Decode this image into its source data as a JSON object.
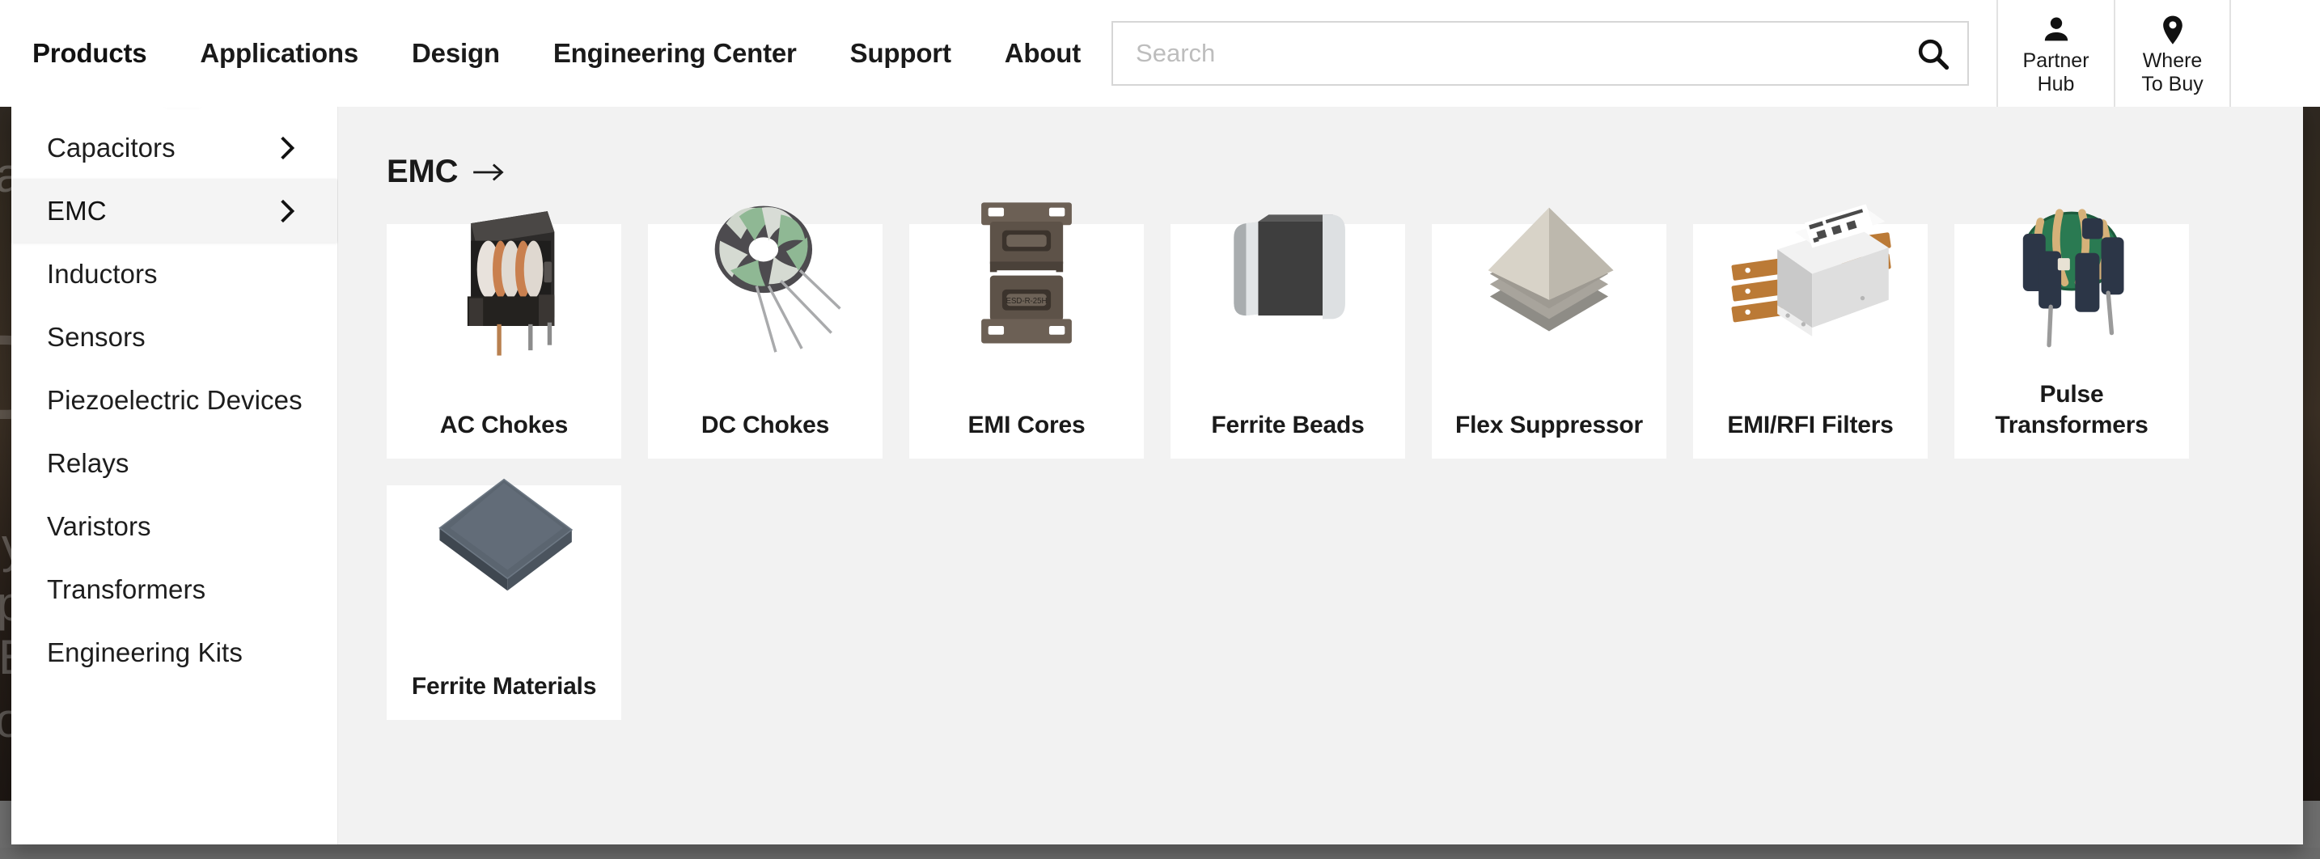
{
  "header": {
    "nav": [
      {
        "label": "Products",
        "active": true
      },
      {
        "label": "Applications",
        "active": false
      },
      {
        "label": "Design",
        "active": false
      },
      {
        "label": "Engineering Center",
        "active": false
      },
      {
        "label": "Support",
        "active": false
      },
      {
        "label": "About",
        "active": false
      }
    ],
    "search": {
      "placeholder": "Search",
      "value": "",
      "icon": "search-icon"
    },
    "utilities": [
      {
        "label": "Partner\nHub",
        "icon": "person-icon"
      },
      {
        "label": "Where\nTo Buy",
        "icon": "location-pin-icon"
      }
    ]
  },
  "dropdown": {
    "sidebar": {
      "items": [
        {
          "label": "Capacitors",
          "has_chevron": true,
          "selected": false
        },
        {
          "label": "EMC",
          "has_chevron": true,
          "selected": true
        },
        {
          "label": "Inductors",
          "has_chevron": false,
          "selected": false
        },
        {
          "label": "Sensors",
          "has_chevron": false,
          "selected": false
        },
        {
          "label": "Piezoelectric Devices",
          "has_chevron": false,
          "selected": false
        },
        {
          "label": "Relays",
          "has_chevron": false,
          "selected": false
        },
        {
          "label": "Varistors",
          "has_chevron": false,
          "selected": false
        },
        {
          "label": "Transformers",
          "has_chevron": false,
          "selected": false
        },
        {
          "label": "Engineering Kits",
          "has_chevron": false,
          "selected": false
        }
      ]
    },
    "panel": {
      "title": "EMC",
      "title_arrow_icon": "arrow-right-icon",
      "cards": [
        {
          "label": "AC Chokes",
          "image": "ac-choke-photo"
        },
        {
          "label": "DC Chokes",
          "image": "dc-choke-toroid-photo"
        },
        {
          "label": "EMI Cores",
          "image": "emi-core-clamp-photo"
        },
        {
          "label": "Ferrite Beads",
          "image": "ferrite-bead-chip-photo"
        },
        {
          "label": "Flex Suppressor",
          "image": "flex-suppressor-sheets-photo"
        },
        {
          "label": "EMI/RFI Filters",
          "image": "emi-rfi-filter-box-photo"
        },
        {
          "label": "Pulse Transformers",
          "image": "pulse-transformer-photo"
        },
        {
          "label": "Ferrite Materials",
          "image": "ferrite-material-plate-photo"
        }
      ]
    }
  },
  "colors": {
    "panel_background": "#f2f2f2",
    "card_background": "#ffffff",
    "sidebar_selected": "#f4f4f4",
    "text_primary": "#1a1a1a",
    "search_border": "#d6d6d6",
    "placeholder": "#bdbdbd"
  },
  "background": {
    "ghost_words": [
      "ag",
      "y",
      "p",
      "E",
      "o",
      "D"
    ]
  }
}
